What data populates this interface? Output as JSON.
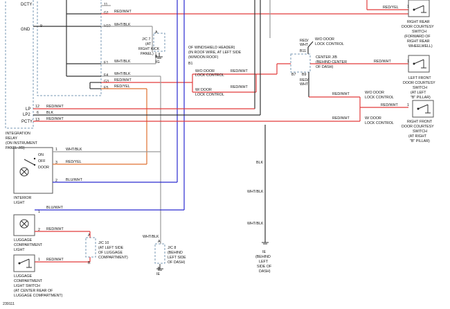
{
  "relay": {
    "pins": {
      "dcty": "DCTY",
      "gnd": "GND",
      "lp": "LP",
      "lp2": "LP2",
      "pcty": "PCTY"
    },
    "pin_nums": {
      "p9": "9",
      "p12": "12",
      "p6": "6",
      "p13": "13",
      "p11": "11",
      "p10": "10",
      "e1": "E1",
      "f4": "F4",
      "g3": "G3",
      "e5": "E5"
    },
    "label": [
      "INTEGRATION",
      "RELAY",
      "(ON INSTRUMENT",
      "PANEL J/B)"
    ]
  },
  "wires": {
    "top_red_wht": "RED/WHT",
    "g1": "G1",
    "g1_label": "RED/WHT",
    "h10": "H10",
    "h10_label": "WHT/BLK",
    "e1_label": "WHT/BLK",
    "f4_label": "WHT/BLK",
    "g3_label": "RED/WHT",
    "e5_label": "RED/YEL",
    "lp_label": "RED/WHT",
    "lp2_label": "BLK",
    "pcty_label": "RED/WHT",
    "jc7_ig_wire": "WHT/BLK",
    "door_lock_wo_label": "RED/WHT",
    "door_lock_w_label": "RED/WHT",
    "red_yel_top": "RED/YEL",
    "red_wht_center": "RED/WHT",
    "red_wht_front_left": "RED/WHT",
    "wo_lock_red_wht": "RED/WHT",
    "w_lock_red_wht": "RED/WHT",
    "wht_blk_int": "WHT/BLK",
    "red_yel_int": "RED/YEL",
    "blu_wht_int": "BLU/WHT",
    "blu_wht_lug": "BLU/WHT",
    "red_wht_lug1": "RED/WHT",
    "red_wht_lug2": "RED/WHT",
    "wht_blk_ie": "WHT/BLK",
    "blk_vert": "BLK",
    "wht_blk_vert1": "WHT/BLK",
    "wht_blk_vert2": "WHT/BLK"
  },
  "jc7": {
    "title": "J/C 7",
    "lines": [
      "(AT",
      "RIGHT KICK",
      "PANEL)"
    ],
    "pin_a": "A",
    "pin_b": "B",
    "ground": "IG"
  },
  "windshield": {
    "lines": [
      "OF WINDSHIELD HEADER)",
      "(IN ROOF WIRE, AT LEFT SIDE",
      "(W/MOON ROOF)"
    ],
    "pin": "B1"
  },
  "door_lock_wo": [
    "W/O DOOR",
    "LOCK CONTROL"
  ],
  "door_lock_w": [
    "W/ DOOR",
    "LOCK CONTROL"
  ],
  "center_jb": {
    "wo_note": [
      "W/O DOOR",
      "LOCK CONTROL"
    ],
    "title": [
      "CENTER J/B",
      "(BEHIND CENTER",
      "OF DASH)"
    ],
    "pins": {
      "b11": "B11",
      "b7": "B7",
      "b9": "B9"
    },
    "red_wht_left": [
      "RED/",
      "WHT"
    ],
    "red_wht_left2": [
      "RED/",
      "WHT"
    ]
  },
  "right_switches": {
    "wo_lock": [
      "W/O DOOR",
      "LOCK CONTROL"
    ],
    "w_lock": [
      "W/ DOOR",
      "LOCK CONTROL"
    ],
    "rear": [
      "RIGHT REAR",
      "DOOR COURTESY",
      "SWITCH",
      "(FORWARD OF",
      "RIGHT REAR",
      "WHEELWELL)"
    ],
    "left_front": [
      "LEFT FRONT",
      "DOOR COURTESY",
      "SWITCH",
      "(AT LEFT",
      "\"B\" PILLAR)"
    ],
    "right_front": [
      "RIGHT FRONT",
      "DOOR COURTESY",
      "SWITCH",
      "(AT RIGHT",
      "\"B\" PILLAR)"
    ],
    "pin1": "1",
    "pin1b": "1",
    "pin1c": "1"
  },
  "interior_light": {
    "on": "ON",
    "off": "OFF",
    "door": "DOOR",
    "pin1": "1",
    "pin3": "3",
    "pin2": "2",
    "label": [
      "INTERIOR",
      "LIGHT"
    ]
  },
  "luggage": {
    "light_label": [
      "LUGGAGE",
      "COMPARTMENT",
      "LIGHT"
    ],
    "switch_label": [
      "LUGGAGE",
      "COMPARTMENT",
      "LIGHT SWITCH",
      "(AT CENTER REAR OF",
      "LUGGAGE COMPARTMENT)"
    ],
    "pin1": "1",
    "pin2": "2",
    "pin1b": "1"
  },
  "jc10": {
    "title": "J/C 10",
    "lines": [
      "(AT LEFT SIDE",
      "OF LUGGAGE",
      "COMPARTMENT)"
    ],
    "pin_a": "A",
    "pin_b": "B"
  },
  "jc8": {
    "title": "J/C 8",
    "lines": [
      "(BEHIND",
      "LEFT SIDE",
      "OF DASH)"
    ],
    "pin_a": "A",
    "pin_b": "B",
    "ground": "IE"
  },
  "ground_ie": {
    "label": "IE",
    "lines": [
      "(BEHIND",
      "LEFT",
      "SIDE OF",
      "DASH)"
    ]
  },
  "figure_id": "239111"
}
